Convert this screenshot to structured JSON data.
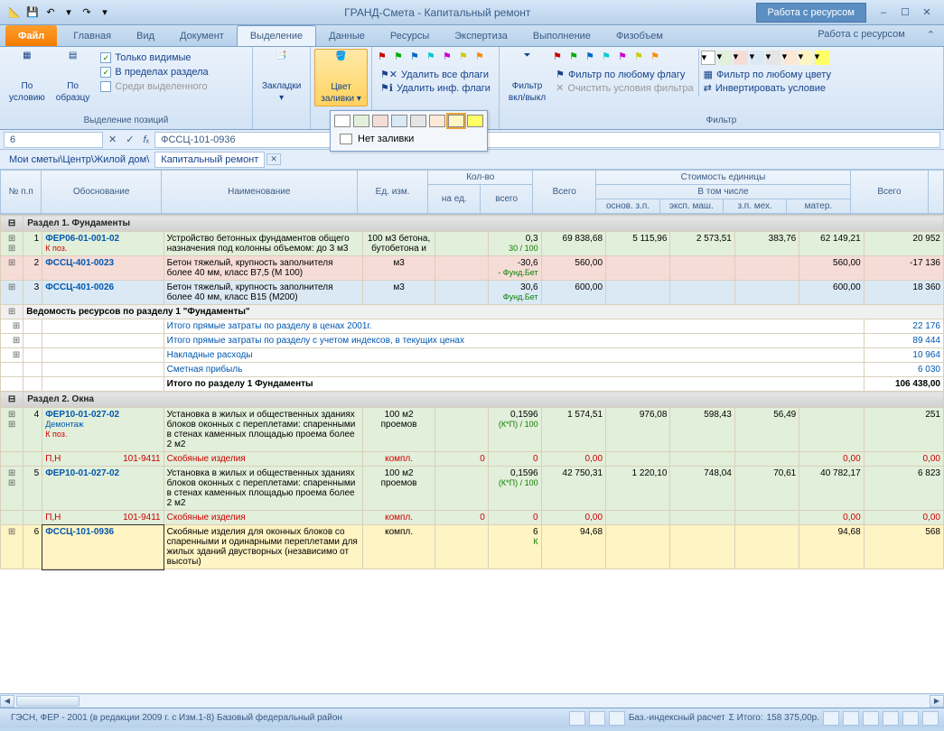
{
  "title": "ГРАНД-Смета - Капитальный ремонт",
  "context_tab": "Работа с ресурсом",
  "qat": {
    "save": "💾",
    "undo": "↶",
    "redo": "↷"
  },
  "win": {
    "min": "–",
    "max": "☐",
    "close": "✕"
  },
  "tabs": {
    "file": "Файл",
    "items": [
      "Главная",
      "Вид",
      "Документ",
      "Выделение",
      "Данные",
      "Ресурсы",
      "Экспертиза",
      "Выполнение",
      "Физобъем"
    ],
    "active_index": 3,
    "ctx": "Работа с ресурсом"
  },
  "ribbon": {
    "group1": {
      "btn1_l1": "По",
      "btn1_l2": "условию",
      "btn2_l1": "По",
      "btn2_l2": "образцу",
      "chk1": "Только видимые",
      "chk2": "В пределах раздела",
      "chk3": "Среди выделенного",
      "label": "Выделение позиций"
    },
    "group2": {
      "btn": "Закладки",
      "label": ""
    },
    "group3": {
      "btn_l1": "Цвет",
      "btn_l2": "заливки",
      "label": ""
    },
    "group4": {
      "del_all": "Удалить все флаги",
      "del_inf": "Удалить инф. флаги",
      "filter_btn_l1": "Фильтр",
      "filter_btn_l2": "вкл/выкл",
      "by_flag": "Фильтр по любому флагу",
      "clear": "Очистить условия фильтра",
      "by_color": "Фильтр по любому цвету",
      "invert": "Инвертировать условие",
      "label": "Фильтр"
    }
  },
  "color_popup": {
    "no_fill": "Нет заливки",
    "colors": [
      "#ffffff",
      "#e2efda",
      "#f6dcd7",
      "#dbe9f5",
      "#e5e5e5",
      "#fce8d4",
      "#fff4c3",
      "#ffff66"
    ]
  },
  "formula": {
    "cell": "6",
    "value": "ФССЦ-101-0936"
  },
  "breadcrumb": {
    "path": "Мои сметы\\Центр\\Жилой дом\\",
    "active": "Капитальный ремонт"
  },
  "headers": {
    "h1": "№ п.п",
    "h2": "Обоснование",
    "h3": "Наименование",
    "h4": "Ед. изм.",
    "h5": "Кол-во",
    "h5a": "на ед.",
    "h5b": "всего",
    "h6": "Всего",
    "h7": "Стоимость единицы",
    "h7a": "В том числе",
    "h7a1": "основ. з.п.",
    "h7a2": "эксп. маш.",
    "h7a3": "з.п. мех.",
    "h7a4": "матер.",
    "h8": "Всего"
  },
  "sections": {
    "s1": "Раздел 1. Фундаменты",
    "s2": "Раздел 2. Окна",
    "res1": "Ведомость ресурсов по разделу 1 \"Фундаменты\""
  },
  "rows": {
    "r1": {
      "n": "1",
      "code": "ФЕР06-01-001-02",
      "kpos": "К поз.",
      "name": "Устройство бетонных фундаментов общего назначения под колонны объемом: до 3 м3",
      "unit": "100 м3 бетона, бутобетона и",
      "q1": "0,3",
      "q1s": "30 / 100",
      "total": "69 838,68",
      "c1": "5 115,96",
      "c2": "2 573,51",
      "c3": "383,76",
      "c4": "62 149,21",
      "sum": "20 952"
    },
    "r2": {
      "n": "2",
      "code": "ФССЦ-401-0023",
      "name": "Бетон тяжелый, крупность заполнителя более 40 мм, класс В7,5 (М 100)",
      "unit": "м3",
      "q1": "-30,6",
      "q1s": "- Фунд.Бет",
      "total": "560,00",
      "c4": "560,00",
      "sum": "-17 136"
    },
    "r3": {
      "n": "3",
      "code": "ФССЦ-401-0026",
      "name": "Бетон тяжелый, крупность заполнителя более 40 мм, класс В15 (М200)",
      "unit": "м3",
      "q1": "30,6",
      "q1s": "Фунд.Бет",
      "total": "600,00",
      "c4": "600,00",
      "sum": "18 360"
    },
    "t1": {
      "label": "Итого прямые затраты по разделу в ценах 2001г.",
      "val": "22 176"
    },
    "t2": {
      "label": "Итого прямые затраты по разделу с учетом индексов, в текущих ценах",
      "val": "89 444"
    },
    "t3": {
      "label": "Накладные расходы",
      "val": "10 964"
    },
    "t4": {
      "label": "Сметная прибыль",
      "val": "6 030"
    },
    "t5": {
      "label": "Итого по разделу 1 Фундаменты",
      "val": "106 438,00"
    },
    "r4": {
      "n": "4",
      "code": "ФЕР10-01-027-02",
      "dm": "Демонтаж",
      "kpos": "К поз.",
      "name": "Установка в жилых и общественных зданиях блоков оконных с переплетами: спаренными в стенах каменных площадью проема более 2 м2",
      "unit": "100 м2 проемов",
      "q1": "0,1596",
      "q1s": "(К*П) / 100",
      "total": "1 574,51",
      "c1": "976,08",
      "c2": "598,43",
      "c3": "56,49",
      "sum": "251"
    },
    "r4a": {
      "pn": "П,Н",
      "code": "101-9411",
      "name": "Скобяные изделия",
      "unit": "компл.",
      "q0": "0",
      "q1": "0",
      "total": "0,00",
      "c4": "0,00",
      "sum": "0,00"
    },
    "r5": {
      "n": "5",
      "code": "ФЕР10-01-027-02",
      "name": "Установка в жилых и общественных зданиях блоков оконных с переплетами: спаренными в стенах каменных площадью проема более 2 м2",
      "unit": "100 м2 проемов",
      "q1": "0,1596",
      "q1s": "(К*П) / 100",
      "total": "42 750,31",
      "c1": "1 220,10",
      "c2": "748,04",
      "c3": "70,61",
      "c4": "40 782,17",
      "sum": "6 823"
    },
    "r5a": {
      "pn": "П,Н",
      "code": "101-9411",
      "name": "Скобяные изделия",
      "unit": "компл.",
      "q0": "0",
      "q1": "0",
      "total": "0,00",
      "c4": "0,00",
      "sum": "0,00"
    },
    "r6": {
      "n": "6",
      "code": "ФССЦ-101-0936",
      "name": "Скобяные изделия для оконных блоков со спаренными и одинарными переплетами для жилых зданий двустворных (независимо от высоты)",
      "unit": "компл.",
      "q1": "6",
      "q1s": "К",
      "total": "94,68",
      "c4": "94,68",
      "sum": "568"
    }
  },
  "status": {
    "left": "ГЭСН, ФЕР - 2001 (в редакции 2009 г. с Изм.1-8)   Базовый федеральный район",
    "mode": "Баз.-индексный расчет",
    "total_label": "Σ Итого:",
    "total_value": "158 375,00р."
  }
}
